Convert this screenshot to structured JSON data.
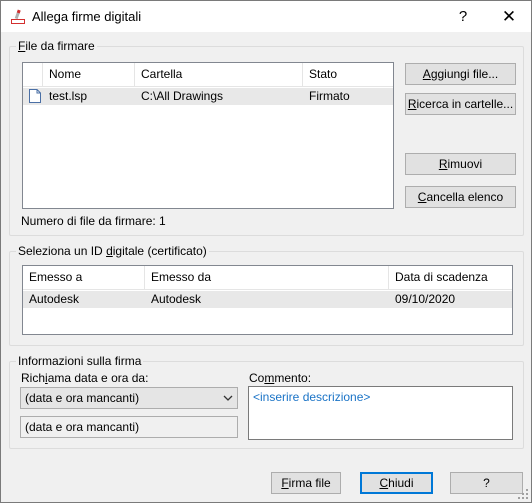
{
  "window": {
    "title": "Allega firme digitali",
    "help_label": "?",
    "close_label": "✕"
  },
  "files_group": {
    "label_pre": "",
    "label_key": "F",
    "label_post": "ile da firmare",
    "columns": [
      "Nome",
      "Cartella",
      "Stato"
    ],
    "rows": [
      {
        "name": "test.lsp",
        "folder": "C:\\All Drawings",
        "status": "Firmato",
        "icon": "document-icon"
      }
    ],
    "count_label": "Numero di file da firmare: 1",
    "buttons": {
      "add": {
        "pre": "",
        "key": "A",
        "post": "ggiungi file..."
      },
      "search": {
        "pre": "",
        "key": "R",
        "post": "icerca in cartelle..."
      },
      "remove": {
        "pre": "",
        "key": "R",
        "post": "imuovi"
      },
      "clear": {
        "pre": "",
        "key": "C",
        "post": "ancella elenco"
      }
    }
  },
  "id_group": {
    "label_pre": "Seleziona un ID ",
    "label_key": "d",
    "label_post": "igitale (certificato)",
    "columns": [
      "Emesso a",
      "Emesso da",
      "Data di scadenza"
    ],
    "rows": [
      {
        "issued_to": "Autodesk",
        "issued_by": "Autodesk",
        "expiry": "09/10/2020"
      }
    ]
  },
  "signature_group": {
    "label": "Informazioni sulla firma",
    "timestamp_label_pre": "Rich",
    "timestamp_label_key": "i",
    "timestamp_label_post": "ama data e ora da:",
    "timestamp_select_value": "(data e ora mancanti)",
    "timestamp_readonly_value": "(data e ora mancanti)",
    "comment_label_pre": "Co",
    "comment_label_key": "m",
    "comment_label_post": "mento:",
    "comment_placeholder": "<inserire descrizione>"
  },
  "footer": {
    "sign": {
      "pre": "",
      "key": "F",
      "post": "irma file"
    },
    "close": {
      "pre": "",
      "key": "C",
      "post": "hiudi"
    },
    "help": "?"
  },
  "colors": {
    "accent": "#0078d7",
    "placeholder_text": "#1a73c6",
    "selected_row": "#e8e8e8"
  }
}
